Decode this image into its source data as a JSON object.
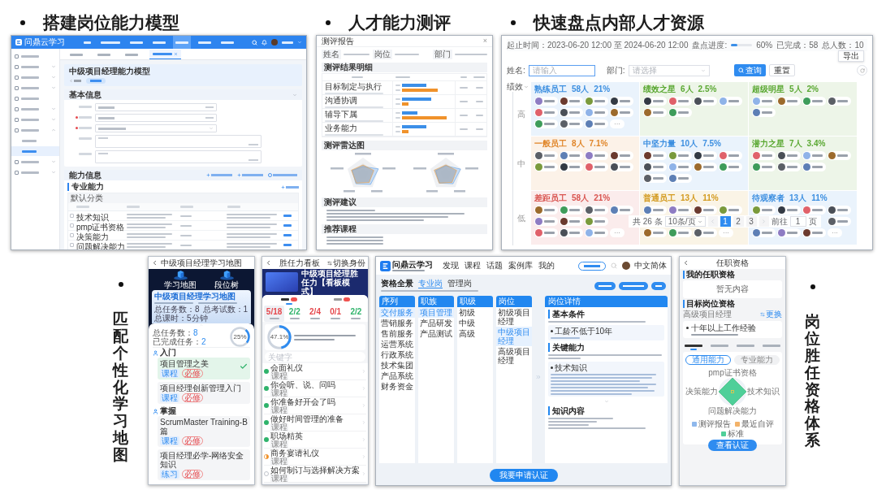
{
  "competency_model": {
    "heading": "搭建岗位能力模型",
    "app_name": "问鼎云学习",
    "nav": [
      {
        "selected": false
      },
      {
        "selected": false
      },
      {
        "selected": false
      },
      {
        "selected": false
      },
      {
        "selected": true
      },
      {
        "selected": false
      },
      {
        "selected": false
      }
    ],
    "sidebar": [
      {
        "kind": "link"
      },
      {
        "kind": "group",
        "expanded": false
      },
      {
        "kind": "group",
        "expanded": false
      },
      {
        "kind": "group",
        "expanded": false
      },
      {
        "kind": "link"
      },
      {
        "kind": "group",
        "expanded": false
      },
      {
        "kind": "group",
        "expanded": false
      },
      {
        "kind": "group",
        "expanded": true,
        "children": [
          {
            "selected": false
          },
          {
            "selected": true
          }
        ]
      },
      {
        "kind": "group",
        "expanded": false
      },
      {
        "kind": "group",
        "expanded": false
      }
    ],
    "tabs": [
      {
        "selected": false
      },
      {
        "selected": false
      },
      {
        "selected": false
      },
      {
        "selected": true
      }
    ],
    "page_title": "中级项目经理能力模型",
    "basic_info": {
      "title": "基本信息",
      "fields": [
        {
          "kind": "input",
          "required": false
        },
        {
          "kind": "input",
          "required": true
        },
        {
          "kind": "select",
          "required": true
        },
        {
          "kind": "textarea",
          "required": false
        },
        {
          "kind": "textarea",
          "required": false
        }
      ]
    },
    "abilities": {
      "title": "能力信息",
      "group": "专业能力",
      "category": "默认分类",
      "rows": [
        {
          "name": "技术知识",
          "checked": false
        },
        {
          "name": "pmp证书资格",
          "checked": false
        },
        {
          "name": "决策能力",
          "checked": false
        },
        {
          "name": "问题解决能力",
          "checked": false
        }
      ]
    }
  },
  "assessment_report": {
    "heading": "人才能力测评",
    "title": "测评报告",
    "close": "×",
    "info_labels": [
      "姓名",
      "岗位",
      "部门"
    ],
    "results_title": "测评结果明细",
    "items": [
      "目标制定与执行",
      "沟通协调",
      "辅导下属",
      "业务能力"
    ],
    "radar_title": "测评雷达图",
    "advice_title": "测评建议",
    "courses_title": "推荐课程"
  },
  "talent_review": {
    "heading": "快速盘点内部人才资源",
    "period": "起止时间：2023-06-20 12:00 至 2024-06-20 12:00",
    "progress": {
      "label": "盘点进度:",
      "level": 0.28,
      "reading": "60%"
    },
    "done": "已完成：58",
    "total": "总人数：10",
    "export": "导出",
    "filters": [
      {
        "kind": "input",
        "label": "姓名:",
        "placeholder": "请输入"
      },
      {
        "kind": "select",
        "label": "部门:",
        "placeholder": "请选择"
      }
    ],
    "search": "查询",
    "reset": "重置",
    "axis": "绩效",
    "levels": [
      "高",
      "中",
      "低"
    ],
    "cells": [
      {
        "title": "熟练员工",
        "count": "58人",
        "share": "21%",
        "color": "#3d8fe0",
        "rows": [
          [
            {
              "kind": "person"
            },
            {
              "kind": "person"
            },
            {
              "kind": "person"
            },
            {
              "kind": "person"
            }
          ],
          [
            {
              "kind": "person"
            },
            {
              "kind": "person"
            },
            {
              "kind": "person"
            },
            {
              "kind": "person"
            }
          ],
          [
            {
              "kind": "person"
            },
            {
              "kind": "person"
            },
            {
              "kind": "person"
            },
            {
              "kind": "more",
              "label": "···"
            }
          ]
        ]
      },
      {
        "title": "绩效之星",
        "count": "6人",
        "share": "2.5%",
        "color": "#5aa832",
        "rows": [
          [
            {
              "kind": "person"
            },
            {
              "kind": "person"
            },
            {
              "kind": "person"
            },
            {
              "kind": "person"
            }
          ],
          [
            {
              "kind": "person"
            },
            {
              "kind": "person"
            }
          ]
        ]
      },
      {
        "title": "超级明星",
        "count": "5人",
        "share": "2%",
        "color": "#5aa832",
        "rows": [
          [
            {
              "kind": "person"
            },
            {
              "kind": "person"
            },
            {
              "kind": "person"
            },
            {
              "kind": "person"
            }
          ],
          [
            {
              "kind": "person"
            }
          ]
        ]
      },
      {
        "title": "一般员工",
        "count": "8人",
        "share": "7.1%",
        "color": "#e0862a",
        "rows": [
          [
            {
              "kind": "person"
            },
            {
              "kind": "person"
            },
            {
              "kind": "person"
            },
            {
              "kind": "person"
            }
          ],
          [
            {
              "kind": "person"
            },
            {
              "kind": "person"
            },
            {
              "kind": "person"
            },
            {
              "kind": "person"
            }
          ]
        ]
      },
      {
        "title": "中坚力量",
        "count": "10人",
        "share": "7.5%",
        "color": "#3d8fe0",
        "rows": [
          [
            {
              "kind": "person"
            },
            {
              "kind": "person"
            },
            {
              "kind": "person"
            },
            {
              "kind": "person"
            }
          ],
          [
            {
              "kind": "person"
            },
            {
              "kind": "person"
            },
            {
              "kind": "person"
            },
            {
              "kind": "person"
            }
          ],
          [
            {
              "kind": "person"
            },
            {
              "kind": "person"
            }
          ]
        ]
      },
      {
        "title": "潜力之星",
        "count": "7人",
        "share": "3.4%",
        "color": "#5aa832",
        "rows": [
          [
            {
              "kind": "person"
            },
            {
              "kind": "person"
            },
            {
              "kind": "person"
            },
            {
              "kind": "person"
            }
          ],
          [
            {
              "kind": "person"
            },
            {
              "kind": "person"
            },
            {
              "kind": "person"
            }
          ]
        ]
      },
      {
        "title": "差距员工",
        "count": "58人",
        "share": "21%",
        "color": "#d9534f",
        "rows": [
          [
            {
              "kind": "person"
            },
            {
              "kind": "person"
            },
            {
              "kind": "person"
            },
            {
              "kind": "person"
            }
          ],
          [
            {
              "kind": "person"
            },
            {
              "kind": "person"
            },
            {
              "kind": "person"
            },
            {
              "kind": "covered"
            }
          ],
          [
            {
              "kind": "person"
            },
            {
              "kind": "person"
            },
            {
              "kind": "person"
            },
            {
              "kind": "more",
              "label": "···"
            }
          ]
        ]
      },
      {
        "title": "普通员工",
        "count": "13人",
        "share": "11%",
        "color": "#d39a1e",
        "rows": [
          [
            {
              "kind": "person"
            },
            {
              "kind": "person"
            },
            {
              "kind": "person"
            },
            {
              "kind": "person"
            }
          ],
          [
            {
              "kind": "covered"
            },
            {
              "kind": "covered"
            },
            {
              "kind": "covered"
            },
            {
              "kind": "covered"
            }
          ],
          [
            {
              "kind": "person"
            },
            {
              "kind": "person"
            },
            {
              "kind": "person"
            },
            {
              "kind": "more",
              "label": "···"
            }
          ]
        ]
      },
      {
        "title": "待观察者",
        "count": "13人",
        "share": "11%",
        "color": "#3d8fe0",
        "rows": [
          [
            {
              "kind": "person"
            },
            {
              "kind": "person"
            },
            {
              "kind": "person"
            },
            {
              "kind": "person"
            }
          ],
          [
            {
              "kind": "covered"
            },
            {
              "kind": "covered"
            },
            {
              "kind": "covered"
            },
            {
              "kind": "person"
            }
          ],
          [
            {
              "kind": "person"
            },
            {
              "kind": "person"
            },
            {
              "kind": "person"
            },
            {
              "kind": "more",
              "label": "···"
            }
          ]
        ]
      }
    ],
    "pager": {
      "total": "共 26 条",
      "size": "10条/页",
      "pages": [
        {
          "label": "1",
          "selected": true
        },
        {
          "label": "2",
          "selected": false
        },
        {
          "label": "3",
          "selected": false
        }
      ],
      "goto": "前往",
      "page": "1",
      "unit": "页"
    }
  },
  "learning_map": {
    "heading": "匹配个性化学习地图",
    "map_phone": {
      "title": "中级项目经理学习地图",
      "modes": [
        {
          "label": "学习地图"
        },
        {
          "label": "段位树"
        }
      ],
      "card": {
        "title": "中级项目经理学习地图",
        "stats": [
          "总任务数：8",
          "总考试数：1",
          "总课时：5分钟"
        ]
      },
      "summary": [
        {
          "label": "总任务数：",
          "value": "8"
        },
        {
          "label": "已完成任务：",
          "value": "2"
        }
      ],
      "ring": {
        "level": 0.25,
        "reading": "25%"
      },
      "stages": [
        {
          "title": "入门",
          "tasks": [
            {
              "type": "课程",
              "title": "项目管理之美",
              "tag": "必修",
              "done": true
            },
            {
              "type": "课程",
              "title": "项目经理创新管理入门",
              "tag": "必修",
              "done": false
            }
          ]
        },
        {
          "title": "掌握",
          "tasks": [
            {
              "type": "课程",
              "title": "ScrumMaster Training-B篇",
              "tag": "必修",
              "done": false
            },
            {
              "type": "练习",
              "title": "项目经理必学-网络安全知识",
              "tag": "必修",
              "done": false
            }
          ]
        }
      ]
    },
    "board_phone": {
      "title": "胜任力看板",
      "switch": "切换身份",
      "banner_title": "中级项目经理胜任力【看板模式】",
      "tabs": [
        {
          "selected": true
        },
        {
          "selected": false
        }
      ],
      "stats": [
        {
          "value": "5/18",
          "color": "#e5484d",
          "selected": true
        },
        {
          "value": "2/2",
          "color": "#2fb36b",
          "selected": false
        },
        {
          "value": "2/4",
          "color": "#e5484d",
          "selected": false
        },
        {
          "value": "0/1",
          "color": "#e5484d",
          "selected": false
        },
        {
          "value": "2/2",
          "color": "#2fb36b",
          "selected": false
        }
      ],
      "progress": {
        "level": 0.471,
        "reading": "47.1%"
      },
      "search_placeholder": "关键字",
      "items": [
        {
          "title": "会面礼仪",
          "type": "课程",
          "kind": "done"
        },
        {
          "title": "你会听、说、问吗",
          "type": "课程",
          "kind": "done"
        },
        {
          "title": "你准备好开会了吗",
          "type": "课程",
          "kind": "done"
        },
        {
          "title": "做好时间管理的准备",
          "type": "课程",
          "kind": "done"
        },
        {
          "title": "职场精英",
          "type": "课程",
          "kind": "done"
        },
        {
          "title": "商务宴请礼仪",
          "type": "课程",
          "kind": "partial"
        },
        {
          "title": "如何制订与选择解决方案",
          "type": "课程",
          "kind": "todo"
        }
      ]
    }
  },
  "qualification": {
    "web": {
      "app_name": "问鼎云学习",
      "nav": [
        "发现",
        "课程",
        "话题",
        "案例库",
        "我的"
      ],
      "language": "中文简体",
      "title": "资格全景",
      "tabs": [
        {
          "label": "专业岗",
          "selected": true
        },
        {
          "label": "管理岗",
          "selected": false
        }
      ],
      "columns": [
        {
          "header": "序列",
          "items": [
            {
              "label": "交付服务",
              "selected": true
            },
            {
              "label": "营销服务",
              "selected": false
            },
            {
              "label": "售前服务",
              "selected": false
            },
            {
              "label": "运营系统",
              "selected": false
            },
            {
              "label": "行政系统",
              "selected": false
            },
            {
              "label": "技术集团",
              "selected": false
            },
            {
              "label": "产品系统",
              "selected": false
            },
            {
              "label": "财务资金",
              "selected": false
            }
          ]
        },
        {
          "header": "职族",
          "items": [
            {
              "label": "项目管理",
              "selected": true
            },
            {
              "label": "产品研发",
              "selected": false
            },
            {
              "label": "产品测试",
              "selected": false
            }
          ]
        },
        {
          "header": "职级",
          "items": [
            {
              "label": "初级",
              "selected": false
            },
            {
              "label": "中级",
              "selected": false
            },
            {
              "label": "高级",
              "selected": false
            }
          ]
        },
        {
          "header": "岗位",
          "items": [
            {
              "label": "初级项目经理",
              "selected": false
            },
            {
              "label": "中级项目经理",
              "selected": true
            },
            {
              "label": "高级项目经理",
              "selected": false
            }
          ]
        }
      ],
      "detail": {
        "header": "岗位详情",
        "sections": [
          {
            "title": "基本条件",
            "card": "工龄不低于10年"
          },
          {
            "title": "关键能力",
            "card": "技术知识"
          },
          {
            "title": "知识内容"
          }
        ]
      },
      "apply": "我要申请认证"
    },
    "phone": {
      "title": "任职资格",
      "mine_title": "我的任职资格",
      "empty": "暂无内容",
      "target_title": "目标岗位资格",
      "target": "高级项目经理",
      "change": "更换",
      "requirement": "十年以上工作经验",
      "tabs": [
        {
          "selected": true
        },
        {
          "selected": false
        },
        {
          "selected": false
        },
        {
          "selected": false
        }
      ],
      "segments": [
        {
          "label": "通用能力",
          "selected": true
        },
        {
          "label": "专业能力",
          "selected": false
        }
      ],
      "radar_labels": [
        "pmp证书资格",
        "技术知识",
        "问题解决能力",
        "决策能力"
      ],
      "legend": [
        {
          "label": "测评报告",
          "color": "#8fb8ec"
        },
        {
          "label": "最近自评",
          "color": "#f3b36a"
        },
        {
          "label": "标准",
          "color": "#4fcf99"
        }
      ],
      "button": "查看认证"
    },
    "heading": "岗位胜任资格体系"
  }
}
